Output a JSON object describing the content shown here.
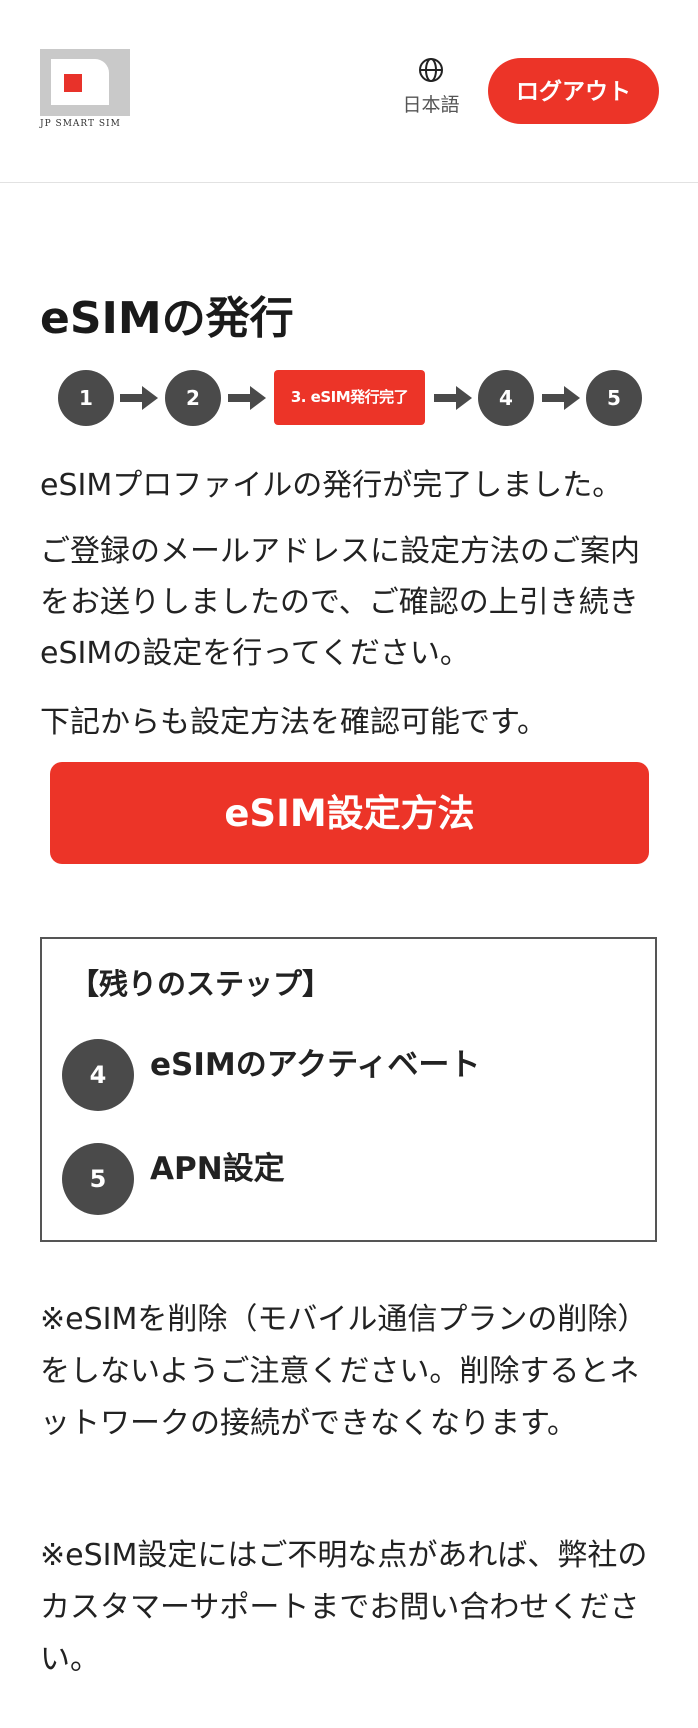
{
  "header": {
    "logo_text": "JP SMART SIM",
    "language_label": "日本語",
    "logout_label": "ログアウト"
  },
  "page_title": "eSIMの発行",
  "stepper": {
    "steps": [
      "1",
      "2",
      "3. eSIM発行完了",
      "4",
      "5"
    ],
    "active_index": 2
  },
  "messages": {
    "complete": "eSIMプロファイルの発行が完了しました。",
    "email_notice": "ご登録のメールアドレスに設定方法のご案内をお送りしましたので、ご確認の上引き続きeSIMの設定を行ってください。",
    "below_notice": "下記からも設定方法を確認可能です。"
  },
  "cta_label": "eSIM設定方法",
  "remaining_steps": {
    "title": "【残りのステップ】",
    "items": [
      {
        "number": "4",
        "label": "eSIMのアクティベート"
      },
      {
        "number": "5",
        "label": "APN設定"
      }
    ]
  },
  "notes": {
    "delete_warning": "※eSIMを削除（モバイル通信プランの削除）をしないようご注意ください。削除するとネットワークの接続ができなくなります。",
    "support": "※eSIM設定にはご不明な点があれば、弊社のカスタマーサポートまでお問い合わせください。"
  },
  "colors": {
    "accent": "#ec3428",
    "step_gray": "#4a4a4a",
    "logo_gray": "#c9c9c9"
  },
  "icons": {
    "language": "globe-icon",
    "step_arrow": "arrow-right-icon"
  }
}
